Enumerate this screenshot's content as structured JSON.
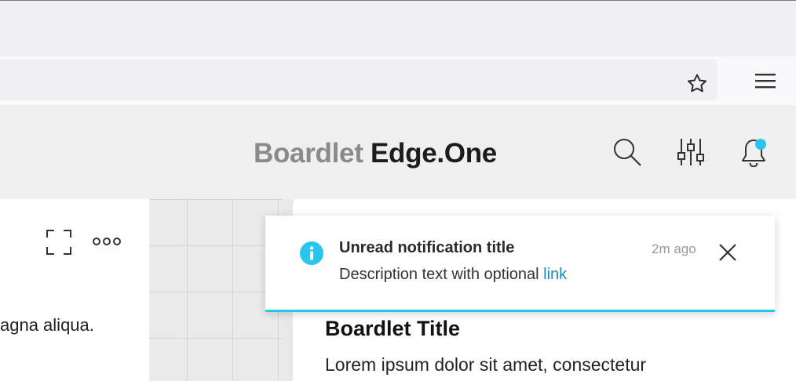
{
  "browser": {
    "star_icon": "star-icon",
    "menu_icon": "hamburger-menu-icon"
  },
  "header": {
    "brand_part1": "Boardlet",
    "brand_part2": "Edge.One",
    "icons": [
      "search-icon",
      "sliders-icon",
      "bell-icon"
    ],
    "notification_badge_color": "#29c5ef"
  },
  "left_card": {
    "text": "agna aliqua.",
    "icons": [
      "expand-icon",
      "more-options-icon"
    ]
  },
  "right_card": {
    "title": "Boardlet Title",
    "body": "Lorem ipsum dolor sit amet, consectetur"
  },
  "notification": {
    "title": "Unread notification title",
    "description": "Description text with optional ",
    "link_text": "link",
    "time": "2m ago",
    "accent_color": "#29c5ef",
    "icon": "info-icon"
  }
}
